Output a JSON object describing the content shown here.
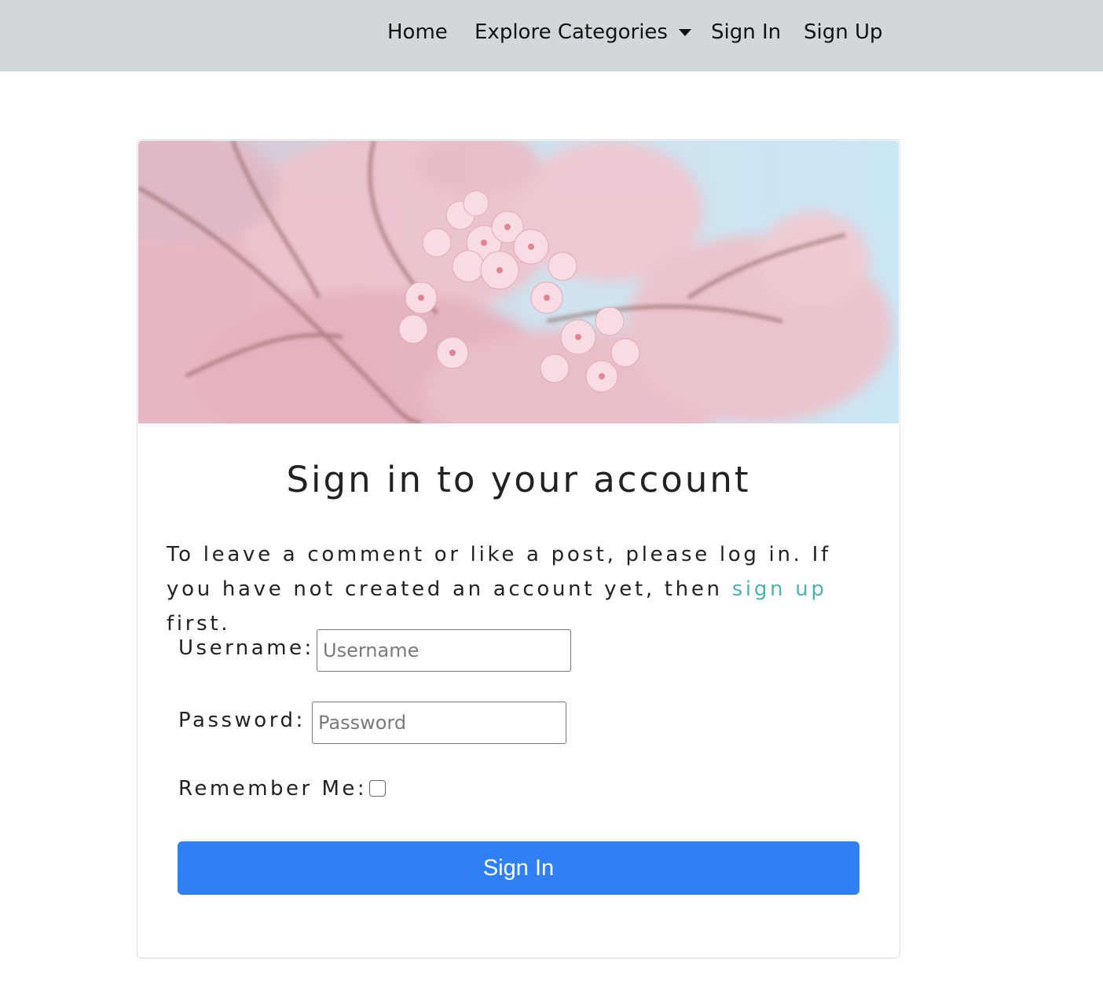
{
  "nav": {
    "home": "Home",
    "explore": "Explore Categories",
    "signin": "Sign In",
    "signup": "Sign Up"
  },
  "hero": {
    "image": "cherry-blossom-photo"
  },
  "card": {
    "title": "Sign in to your account",
    "intro_before": "To leave a comment or like a post, please log in. If you have not created an account yet, then ",
    "intro_link": "sign up",
    "intro_after": " first."
  },
  "form": {
    "username_label": "Username:",
    "username_placeholder": "Username",
    "username_value": "",
    "password_label": "Password:",
    "password_placeholder": "Password",
    "password_value": "",
    "remember_label": "Remember Me:",
    "remember_checked": false,
    "submit_label": "Sign In"
  },
  "colors": {
    "navbar_bg": "#d2d8da",
    "link": "#4bb3b0",
    "primary_button": "#2f80f5"
  }
}
